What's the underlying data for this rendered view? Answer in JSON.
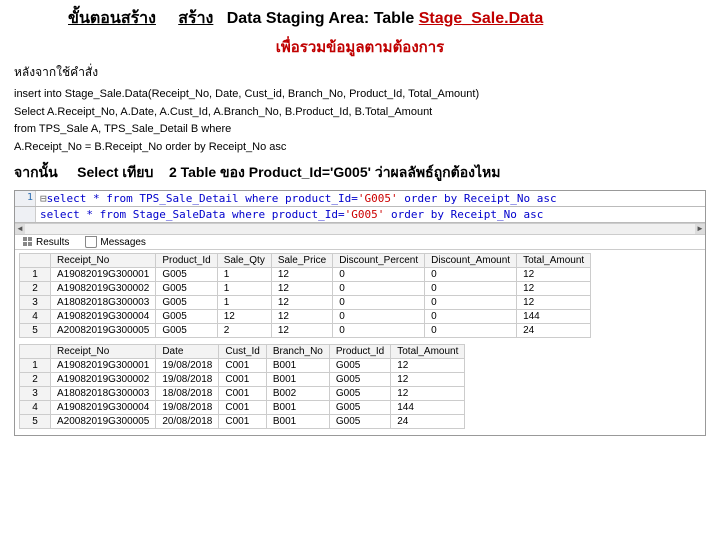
{
  "header": {
    "txt_a": "ขั้นตอนสร้าง",
    "txt_b": "สร้าง",
    "txt_c": "Data Staging Area: Table",
    "txt_d": "Stage_Sale.Data",
    "subtitle": "เพื่อรวมข้อมูลตามต้องการ",
    "after_sql_label": "หลังจากใช้คำสั่ง"
  },
  "insert_sql": {
    "l1": "insert into Stage_Sale.Data(Receipt_No, Date, Cust_id, Branch_No, Product_Id, Total_Amount)",
    "l2": "Select A.Receipt_No, A.Date, A.Cust_Id, A.Branch_No, B.Product_Id, B.Total_Amount",
    "l3": "from TPS_Sale A, TPS_Sale_Detail B where",
    "l4": "A.Receipt_No = B.Receipt_No order by Receipt_No asc"
  },
  "line2": {
    "a": "จากนั้น",
    "b": "Select เทียบ",
    "c": "2 Table ของ Product_Id='G005' ว่าผลลัพธ์ถูกต้องไหม"
  },
  "editor": {
    "gutter": "1",
    "q1_pre": "select * from TPS_Sale_Detail where product_Id=",
    "q1_str": "'G005'",
    "q1_post": " order by Receipt_No asc",
    "q2_pre": "select * from Stage_SaleData where product_Id=",
    "q2_str": "'G005'",
    "q2_post": " order by Receipt_No asc",
    "tab_results": "Results",
    "tab_messages": "Messages"
  },
  "table1": {
    "headers": [
      "",
      "Receipt_No",
      "Product_Id",
      "Sale_Qty",
      "Sale_Price",
      "Discount_Percent",
      "Discount_Amount",
      "Total_Amount"
    ],
    "rows": [
      [
        "1",
        "A19082019G300001",
        "G005",
        "1",
        "12",
        "0",
        "0",
        "12"
      ],
      [
        "2",
        "A19082019G300002",
        "G005",
        "1",
        "12",
        "0",
        "0",
        "12"
      ],
      [
        "3",
        "A18082018G300003",
        "G005",
        "1",
        "12",
        "0",
        "0",
        "12"
      ],
      [
        "4",
        "A19082019G300004",
        "G005",
        "12",
        "12",
        "0",
        "0",
        "144"
      ],
      [
        "5",
        "A20082019G300005",
        "G005",
        "2",
        "12",
        "0",
        "0",
        "24"
      ]
    ]
  },
  "table2": {
    "headers": [
      "",
      "Receipt_No",
      "Date",
      "Cust_Id",
      "Branch_No",
      "Product_Id",
      "Total_Amount"
    ],
    "rows": [
      [
        "1",
        "A19082019G300001",
        "19/08/2018",
        "C001",
        "B001",
        "G005",
        "12"
      ],
      [
        "2",
        "A19082019G300002",
        "19/08/2018",
        "C001",
        "B001",
        "G005",
        "12"
      ],
      [
        "3",
        "A18082018G300003",
        "18/08/2018",
        "C001",
        "B002",
        "G005",
        "12"
      ],
      [
        "4",
        "A19082019G300004",
        "19/08/2018",
        "C001",
        "B001",
        "G005",
        "144"
      ],
      [
        "5",
        "A20082019G300005",
        "20/08/2018",
        "C001",
        "B001",
        "G005",
        "24"
      ]
    ]
  }
}
